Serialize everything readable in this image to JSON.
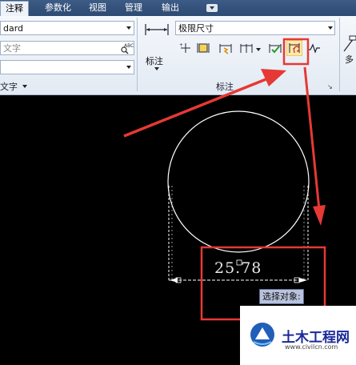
{
  "tabs": [
    "注释",
    "参数化",
    "视图",
    "管理",
    "输出"
  ],
  "style_panel": {
    "text_style_value": "dard",
    "search_placeholder": "文字",
    "third_combo_value": "",
    "panel_title": "文字"
  },
  "dimension_panel": {
    "large_button_label": "标注",
    "dimstyle_value": "极限尺寸",
    "panel_title": "标注"
  },
  "right_panel": {
    "partial_label": "多"
  },
  "canvas": {
    "dimension_text": "25.78",
    "prompt_tooltip": "选择对象:"
  },
  "watermark": {
    "brand": "土木工程网",
    "url": "www.civilcn.com"
  },
  "colors": {
    "annotation": "#e53935",
    "geometry": "#ffffff",
    "background": "#000000",
    "ribbon": "#eef3fa"
  }
}
